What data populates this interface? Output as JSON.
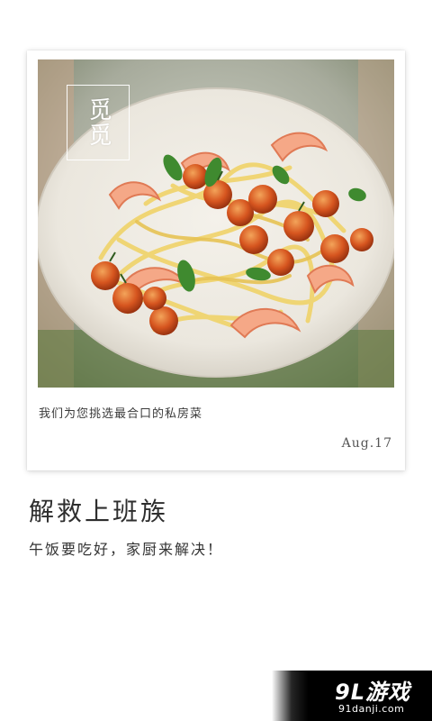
{
  "card": {
    "logo_text": "觅觅",
    "caption": "我们为您挑选最合口的私房菜",
    "date": "Aug.17"
  },
  "headline": "解救上班族",
  "subline": "午饭要吃好，家厨来解决！",
  "watermark": {
    "main": "9L游戏",
    "sub": "91danji.com"
  }
}
